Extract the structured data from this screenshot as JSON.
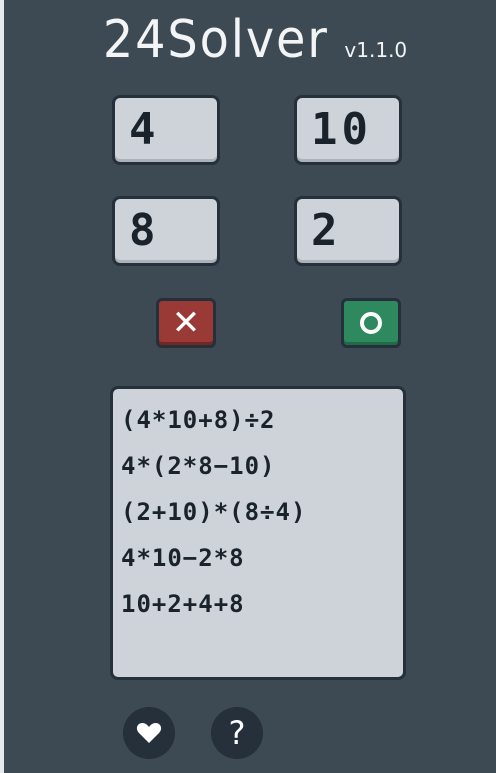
{
  "app": {
    "title": "24Solver",
    "version": "v1.1.0"
  },
  "numbers": [
    "4",
    "10",
    "8",
    "2"
  ],
  "buttons": {
    "clear_symbol": "✕",
    "solve_icon": "circle-icon"
  },
  "solutions": [
    "(4*10+8)÷2",
    "4*(2*8−10)",
    "(2+10)*(8÷4)",
    "4*10−2*8",
    "10+2+4+8"
  ],
  "footer": {
    "like_icon": "heart-icon",
    "help_label": "?"
  },
  "colors": {
    "background": "#3d4a53",
    "panel": "#cdd3d9",
    "clear_button": "#9a3a36",
    "solve_button": "#2e8a5e",
    "round_button": "#25303a"
  }
}
